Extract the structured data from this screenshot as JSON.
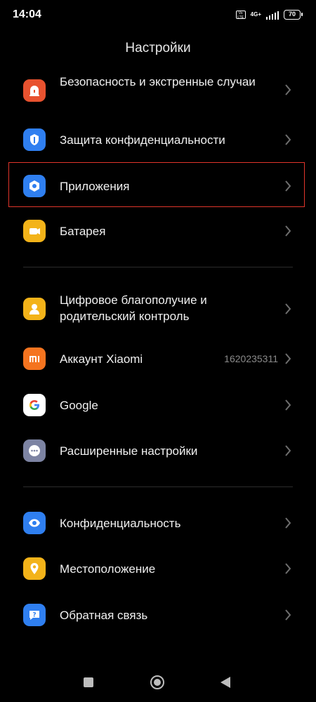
{
  "status_bar": {
    "time": "14:04",
    "volte": "Vo LTE",
    "network": "4G+",
    "battery": "70"
  },
  "header": {
    "title": "Настройки"
  },
  "colors": {
    "background": "#000000",
    "highlight_border": "#e0352b",
    "chevron": "#6e6e6e",
    "secondary_text": "#8a8a8a"
  },
  "settings": {
    "security": {
      "label": "Безопасность и экстренные случаи",
      "icon": "emergency-siren-icon",
      "color": "#e8522f"
    },
    "privacy_protection": {
      "label": "Защита конфиденциальности",
      "icon": "shield-icon",
      "color": "#2f7ff0"
    },
    "apps": {
      "label": "Приложения",
      "icon": "hexagon-gear-icon",
      "color": "#2f7ff0"
    },
    "battery": {
      "label": "Батарея",
      "icon": "battery-icon",
      "color": "#f3b319"
    },
    "digital_wellbeing": {
      "label": "Цифровое благополучие и родительский контроль",
      "icon": "parental-user-icon",
      "color": "#f3b319"
    },
    "xiaomi_account": {
      "label": "Аккаунт Xiaomi",
      "value": "1620235311",
      "icon": "mi-logo-icon",
      "color": "#f5741f"
    },
    "google": {
      "label": "Google",
      "icon": "google-g-icon",
      "color": "#ffffff"
    },
    "advanced": {
      "label": "Расширенные настройки",
      "icon": "more-dots-icon",
      "color": "#7d84a3"
    },
    "privacy": {
      "label": "Конфиденциальность",
      "icon": "eye-icon",
      "color": "#2f7ff0"
    },
    "location": {
      "label": "Местоположение",
      "icon": "location-pin-icon",
      "color": "#f3b319"
    },
    "feedback": {
      "label": "Обратная связь",
      "icon": "question-bubble-icon",
      "color": "#2f7ff0"
    }
  }
}
